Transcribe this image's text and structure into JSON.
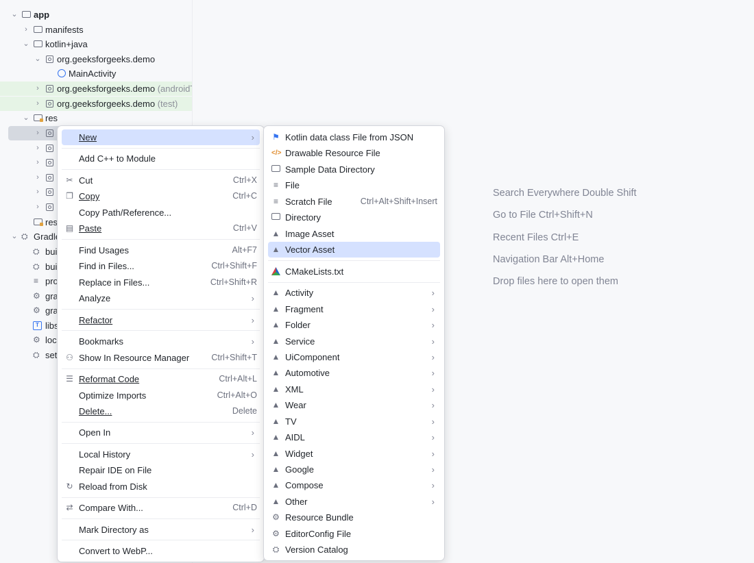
{
  "tree": {
    "app": "app",
    "manifests": "manifests",
    "kotlin_java": "kotlin+java",
    "pkg_main": "org.geeksforgeeks.demo",
    "main_activity": "MainActivity",
    "pkg_android_test": "org.geeksforgeeks.demo",
    "pkg_android_test_hint": "(androidT",
    "pkg_test": "org.geeksforgeeks.demo",
    "pkg_test_hint": "(test)",
    "res": "res",
    "res_partial": "res",
    "gradle_partial": "Gradle",
    "bui1": "bui",
    "bui2": "bui",
    "pro": "pro",
    "gra1": "gra",
    "gra2": "gra",
    "libs": "libs",
    "loc": "loc",
    "set": "set"
  },
  "main_menu": {
    "new": "New",
    "add_cpp": "Add C++ to Module",
    "cut": "Cut",
    "cut_sc": "Ctrl+X",
    "copy": "Copy",
    "copy_sc": "Ctrl+C",
    "copy_path": "Copy Path/Reference...",
    "paste": "Paste",
    "paste_sc": "Ctrl+V",
    "find_usages": "Find Usages",
    "find_usages_sc": "Alt+F7",
    "find_in_files": "Find in Files...",
    "find_in_files_sc": "Ctrl+Shift+F",
    "replace_in_files": "Replace in Files...",
    "replace_in_files_sc": "Ctrl+Shift+R",
    "analyze": "Analyze",
    "refactor": "Refactor",
    "bookmarks": "Bookmarks",
    "show_res_mgr": "Show In Resource Manager",
    "show_res_mgr_sc": "Ctrl+Shift+T",
    "reformat": "Reformat Code",
    "reformat_sc": "Ctrl+Alt+L",
    "optimize": "Optimize Imports",
    "optimize_sc": "Ctrl+Alt+O",
    "delete": "Delete...",
    "delete_sc": "Delete",
    "open_in": "Open In",
    "local_history": "Local History",
    "repair": "Repair IDE on File",
    "reload": "Reload from Disk",
    "compare": "Compare With...",
    "compare_sc": "Ctrl+D",
    "mark_dir": "Mark Directory as",
    "convert": "Convert to WebP..."
  },
  "sub_menu": {
    "kotlin_json": "Kotlin data class File from JSON",
    "drawable": "Drawable Resource File",
    "sample_data": "Sample Data Directory",
    "file": "File",
    "scratch": "Scratch File",
    "scratch_sc": "Ctrl+Alt+Shift+Insert",
    "directory": "Directory",
    "image_asset": "Image Asset",
    "vector_asset": "Vector Asset",
    "cmake": "CMakeLists.txt",
    "activity": "Activity",
    "fragment": "Fragment",
    "folder": "Folder",
    "service": "Service",
    "uicomponent": "UiComponent",
    "automotive": "Automotive",
    "xml": "XML",
    "wear": "Wear",
    "tv": "TV",
    "aidl": "AIDL",
    "widget": "Widget",
    "google": "Google",
    "compose": "Compose",
    "other": "Other",
    "resource_bundle": "Resource Bundle",
    "editorconfig": "EditorConfig File",
    "version_catalog": "Version Catalog"
  },
  "empty_editor": {
    "search": "Search Everywhere Double Shift",
    "goto_file": "Go to File Ctrl+Shift+N",
    "recent": "Recent Files Ctrl+E",
    "navbar": "Navigation Bar Alt+Home",
    "drop": "Drop files here to open them"
  }
}
